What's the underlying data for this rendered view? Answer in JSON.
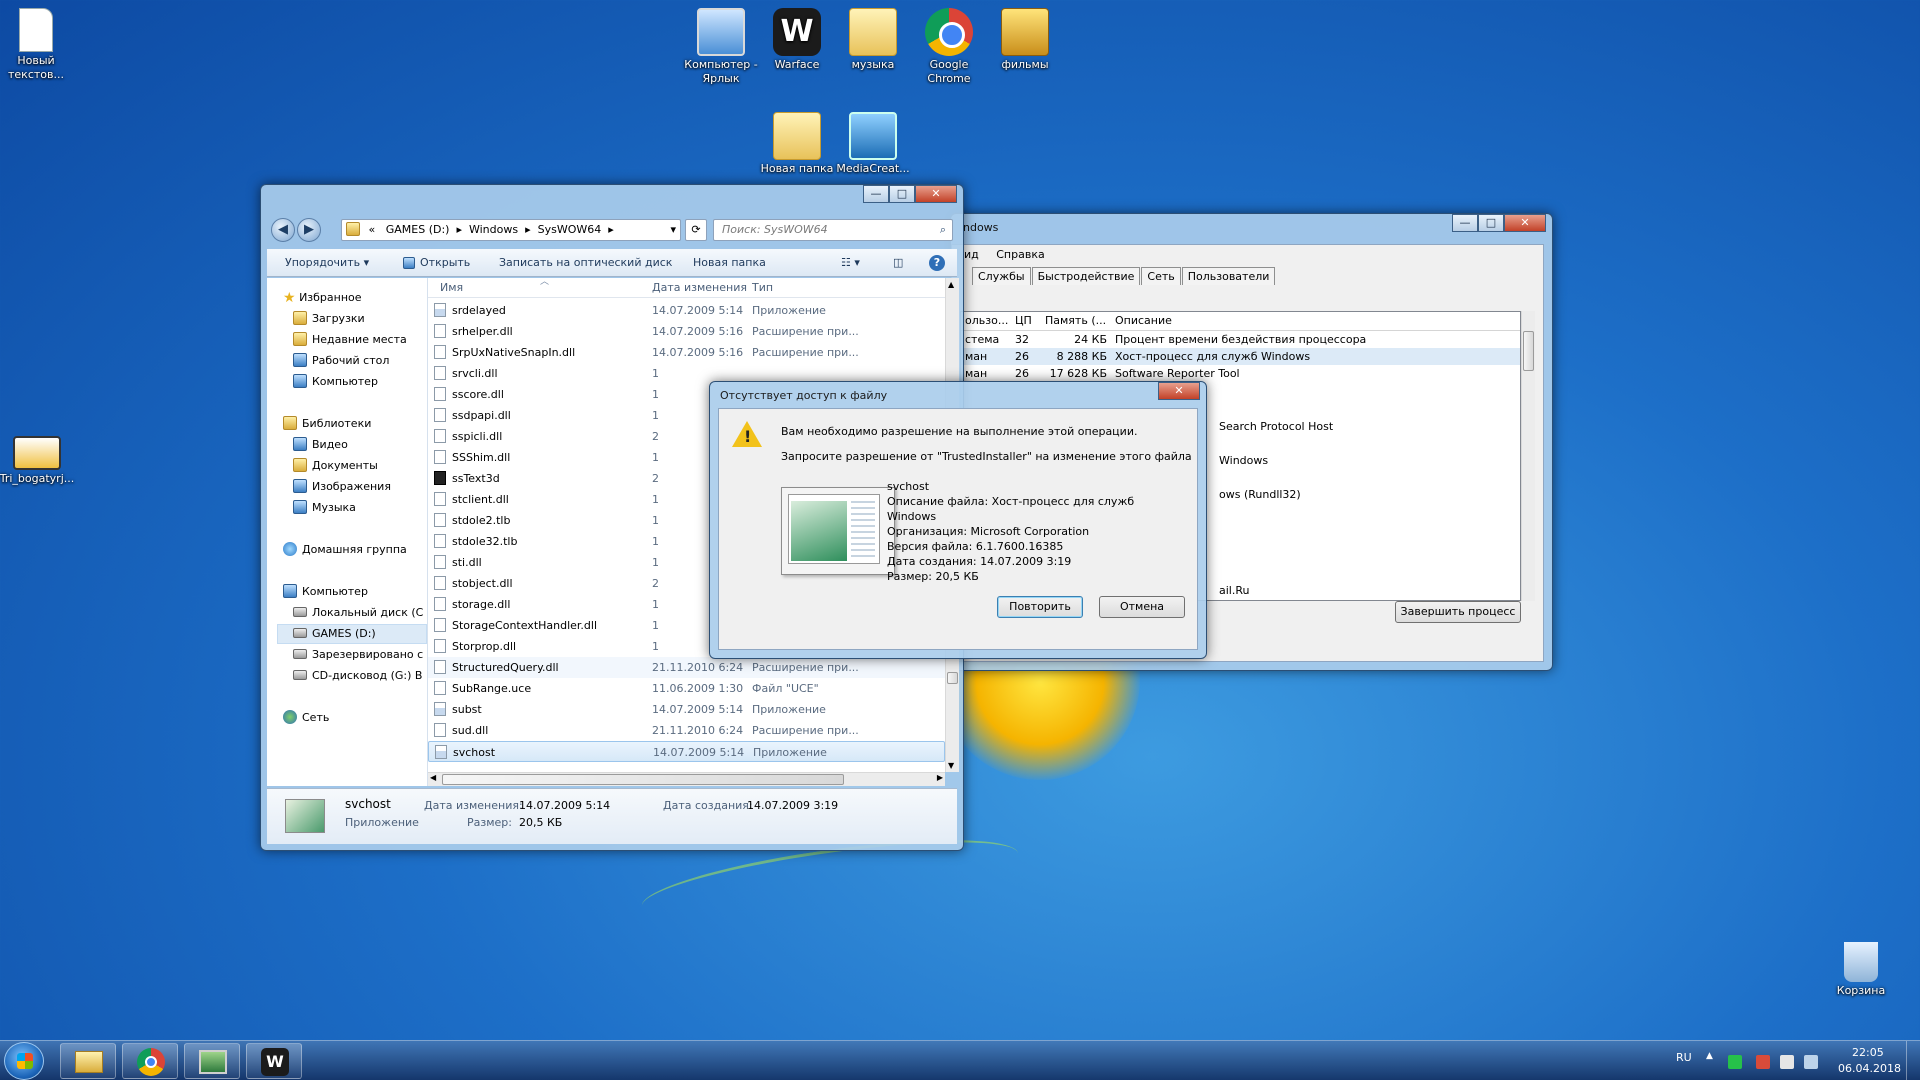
{
  "desktop_icons": [
    {
      "label": "Новый текстов..."
    },
    {
      "label": "Компьютер - Ярлык"
    },
    {
      "label": "Warface"
    },
    {
      "label": "музыка"
    },
    {
      "label": "Google Chrome"
    },
    {
      "label": "фильмы"
    },
    {
      "label": "Новая папка"
    },
    {
      "label": "MediaCreat..."
    },
    {
      "label": "Tri_bogatyrj..."
    },
    {
      "label": "Корзина"
    }
  ],
  "task_manager": {
    "title_partial": "ndows",
    "menu": [
      "ид",
      "Справка"
    ],
    "tabs": [
      "Службы",
      "Быстродействие",
      "Сеть",
      "Пользователи"
    ],
    "columns": [
      "ользо...",
      "ЦП",
      "Память (...",
      "Описание"
    ],
    "rows": [
      {
        "user": "стема",
        "cpu": "32",
        "mem": "24 КБ",
        "desc": "Процент времени бездействия процессора"
      },
      {
        "user": "ман",
        "cpu": "26",
        "mem": "8 288 КБ",
        "desc": "Хост-процесс для служб Windows"
      },
      {
        "user": "ман",
        "cpu": "26",
        "mem": "17 628 КБ",
        "desc": "Software Reporter Tool"
      }
    ],
    "partial_desc": [
      "Search Protocol Host",
      "Windows",
      "ows (Rundll32)",
      "ail.Ru"
    ],
    "end_process": "Завершить процесс"
  },
  "explorer": {
    "breadcrumb": [
      "«",
      "GAMES (D:)",
      "Windows",
      "SysWOW64"
    ],
    "search_placeholder": "Поиск: SysWOW64",
    "toolbar": {
      "organize": "Упорядочить",
      "open": "Открыть",
      "burn": "Записать на оптический диск",
      "new_folder": "Новая папка"
    },
    "nav": {
      "favorites": "Избранное",
      "downloads": "Загрузки",
      "recent": "Недавние места",
      "desktop": "Рабочий стол",
      "computer_fav": "Компьютер",
      "libraries": "Библиотеки",
      "video": "Видео",
      "documents": "Документы",
      "images": "Изображения",
      "music": "Музыка",
      "homegroup": "Домашняя группа",
      "computer": "Компьютер",
      "local_disk": "Локальный диск (C",
      "games": "GAMES (D:)",
      "reserved": "Зарезервировано с",
      "cd": "CD-дисковод (G:) B",
      "network": "Сеть"
    },
    "columns": {
      "name": "Имя",
      "date": "Дата изменения",
      "type": "Тип"
    },
    "files": [
      {
        "name": "srdelayed",
        "date": "14.07.2009 5:14",
        "type": "Приложение",
        "kind": "exe"
      },
      {
        "name": "srhelper.dll",
        "date": "14.07.2009 5:16",
        "type": "Расширение при...",
        "kind": "dll"
      },
      {
        "name": "SrpUxNativeSnapIn.dll",
        "date": "14.07.2009 5:16",
        "type": "Расширение при...",
        "kind": "dll"
      },
      {
        "name": "srvcli.dll",
        "date": "1",
        "type": "",
        "kind": "dll"
      },
      {
        "name": "sscore.dll",
        "date": "1",
        "type": "",
        "kind": "dll"
      },
      {
        "name": "ssdpapi.dll",
        "date": "1",
        "type": "",
        "kind": "dll"
      },
      {
        "name": "sspicli.dll",
        "date": "2",
        "type": "",
        "kind": "dll"
      },
      {
        "name": "SSShim.dll",
        "date": "1",
        "type": "",
        "kind": "dll"
      },
      {
        "name": "ssText3d",
        "date": "2",
        "type": "",
        "kind": "dark"
      },
      {
        "name": "stclient.dll",
        "date": "1",
        "type": "",
        "kind": "dll"
      },
      {
        "name": "stdole2.tlb",
        "date": "1",
        "type": "",
        "kind": "dll"
      },
      {
        "name": "stdole32.tlb",
        "date": "1",
        "type": "",
        "kind": "dll"
      },
      {
        "name": "sti.dll",
        "date": "1",
        "type": "",
        "kind": "dll"
      },
      {
        "name": "stobject.dll",
        "date": "2",
        "type": "",
        "kind": "dll"
      },
      {
        "name": "storage.dll",
        "date": "1",
        "type": "",
        "kind": "dll"
      },
      {
        "name": "StorageContextHandler.dll",
        "date": "1",
        "type": "",
        "kind": "dll"
      },
      {
        "name": "Storprop.dll",
        "date": "1",
        "type": "",
        "kind": "dll"
      },
      {
        "name": "StructuredQuery.dll",
        "date": "21.11.2010 6:24",
        "type": "Расширение при...",
        "kind": "dll"
      },
      {
        "name": "SubRange.uce",
        "date": "11.06.2009 1:30",
        "type": "Файл \"UCE\"",
        "kind": "dll"
      },
      {
        "name": "subst",
        "date": "14.07.2009 5:14",
        "type": "Приложение",
        "kind": "exe"
      },
      {
        "name": "sud.dll",
        "date": "21.11.2010 6:24",
        "type": "Расширение при...",
        "kind": "dll"
      },
      {
        "name": "svchost",
        "date": "14.07.2009 5:14",
        "type": "Приложение",
        "kind": "exe"
      }
    ],
    "details": {
      "name": "svchost",
      "type": "Приложение",
      "modified_label": "Дата изменения:",
      "modified": "14.07.2009 5:14",
      "created_label": "Дата создания:",
      "created": "14.07.2009 3:19",
      "size_label": "Размер:",
      "size": "20,5 КБ"
    }
  },
  "dialog": {
    "title": "Отсутствует доступ к файлу",
    "message": "Вам необходимо разрешение на выполнение этой операции.",
    "request": "Запросите разрешение от \"TrustedInstaller\" на изменение этого файла",
    "file_name": "svchost",
    "desc_line1": "Описание файла: Хост-процесс для служб",
    "desc_line2": "Windows",
    "org": "Организация: Microsoft Corporation",
    "version": "Версия файла: 6.1.7600.16385",
    "created": "Дата создания: 14.07.2009 3:19",
    "size": "Размер: 20,5 КБ",
    "retry": "Повторить",
    "cancel": "Отмена"
  },
  "taskbar": {
    "lang": "RU",
    "time": "22:05",
    "date": "06.04.2018"
  }
}
